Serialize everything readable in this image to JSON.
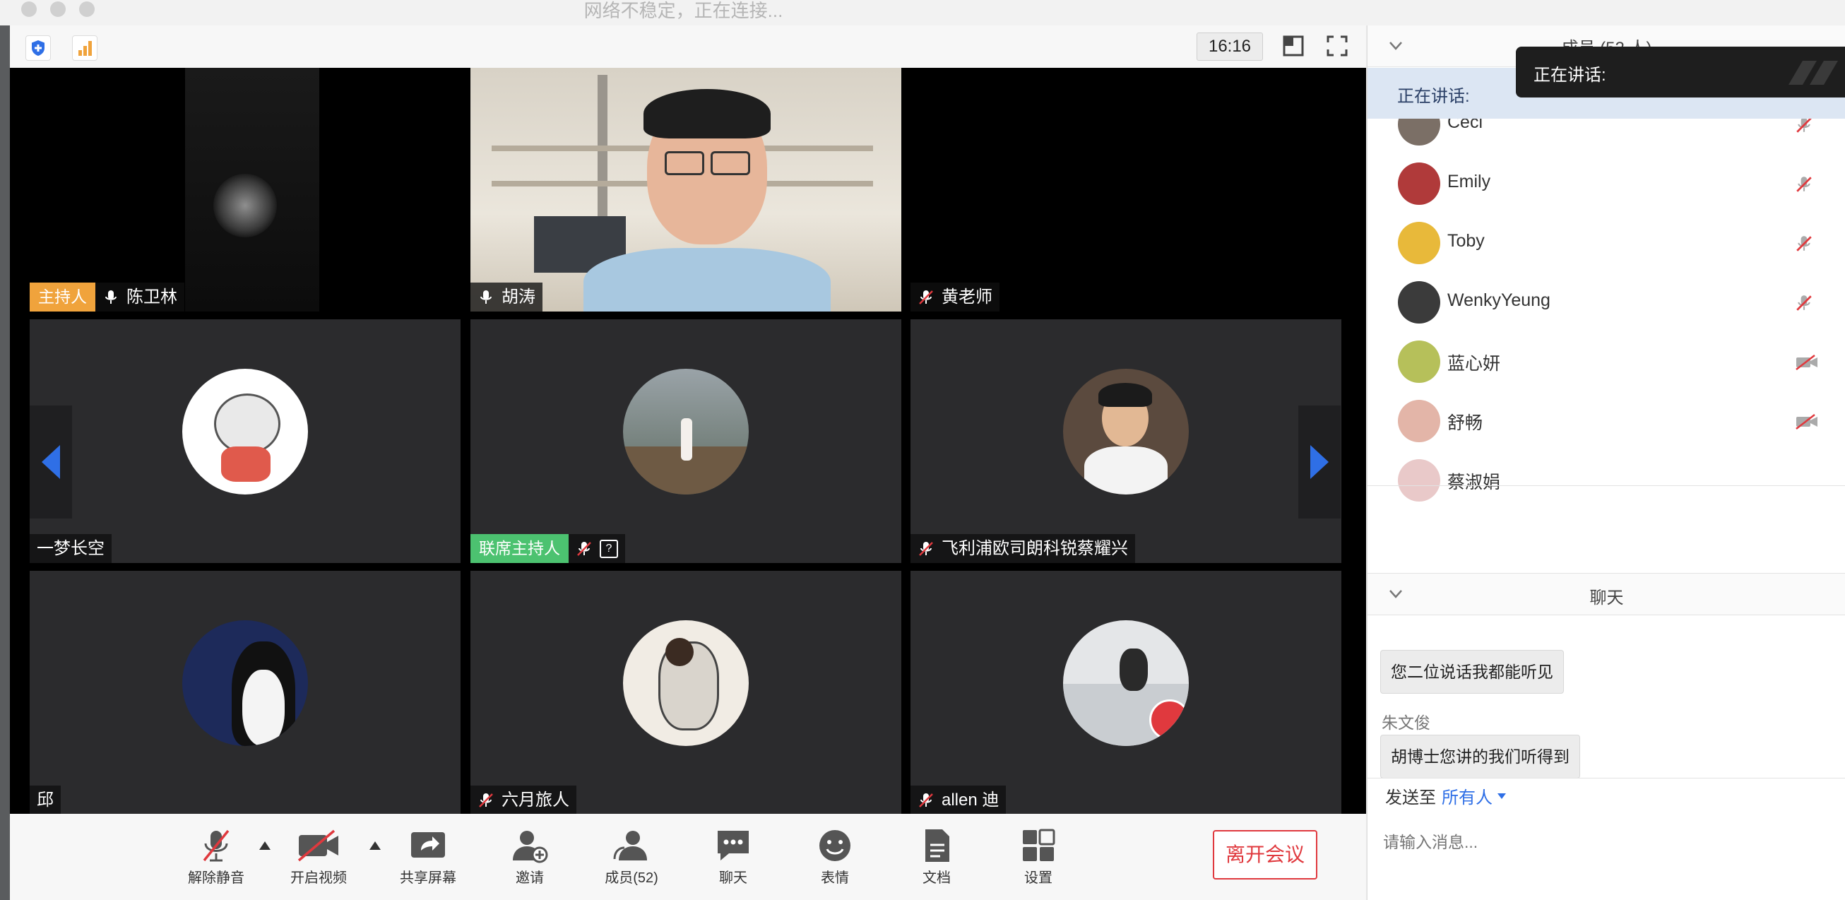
{
  "window": {
    "title": "网络不稳定，正在连接...",
    "time": "16:16"
  },
  "videos": [
    {
      "name": "陈卫林",
      "role": "主持人",
      "role_color": "#f0a33c",
      "mic": "on"
    },
    {
      "name": "胡涛",
      "mic": "on"
    },
    {
      "name": "黄老师",
      "mic": "muted"
    },
    {
      "name": "一梦长空",
      "mic": "none"
    },
    {
      "name": "",
      "role": "联席主持人",
      "role_color": "#4cc270",
      "mic": "muted",
      "extra_icon": "?"
    },
    {
      "name": "飞利浦欧司朗科锐蔡耀兴",
      "mic": "muted"
    },
    {
      "name": "邱",
      "mic": "none"
    },
    {
      "name": "六月旅人",
      "mic": "muted"
    },
    {
      "name": "allen 迪",
      "mic": "muted"
    }
  ],
  "toolbar": {
    "unmute": "解除静音",
    "start_video": "开启视频",
    "share": "共享屏幕",
    "invite": "邀请",
    "members": "成员(52)",
    "chat": "聊天",
    "emoji": "表情",
    "docs": "文档",
    "settings": "设置",
    "leave": "离开会议"
  },
  "panel": {
    "members_header": "成员 (52 人)",
    "speaking_label": "正在讲话:",
    "speaking_popup": "正在讲话:",
    "members": [
      {
        "name": "Ceci",
        "status": "mic-muted",
        "color": "#7b6f66"
      },
      {
        "name": "Emily",
        "status": "mic-muted",
        "color": "#b03a3a"
      },
      {
        "name": "Toby",
        "status": "mic-muted",
        "color": "#e8b93a"
      },
      {
        "name": "WenkyYeung",
        "status": "mic-muted",
        "color": "#3b3b3b"
      },
      {
        "name": "蓝心妍",
        "status": "video-off",
        "color": "#b6c05a"
      },
      {
        "name": "舒畅",
        "status": "video-off",
        "color": "#e3b5a8"
      },
      {
        "name": "蔡淑娟",
        "status": "none",
        "color": "#e9c9c9"
      }
    ],
    "chat_header": "聊天",
    "chat": [
      {
        "sender": "",
        "text": "您二位说话我都能听见"
      },
      {
        "sender": "朱文俊",
        "text": "胡博士您讲的我们听得到"
      }
    ],
    "send_to_label": "发送至",
    "send_to_target": "所有人",
    "input_placeholder": "请输入消息..."
  },
  "colors": {
    "accent": "#2f6fe6",
    "leave": "#e0393e",
    "host": "#f0a33c",
    "cohost": "#4cc270"
  }
}
